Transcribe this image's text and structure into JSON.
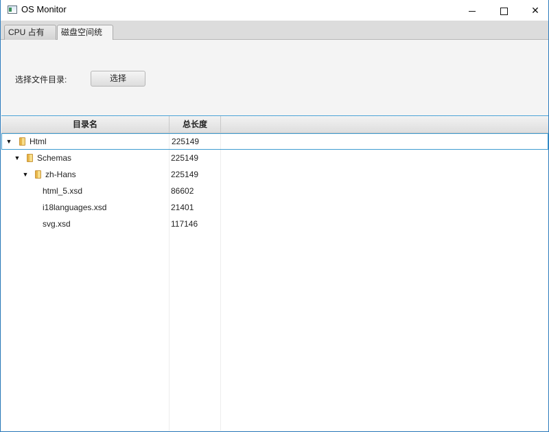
{
  "window": {
    "title": "OS Monitor",
    "controls": {
      "minimize": "minimize",
      "maximize": "maximize",
      "close": "✕"
    }
  },
  "tabs": [
    {
      "label": "CPU 占有率",
      "selected": false
    },
    {
      "label": "磁盘空间统计",
      "selected": true
    }
  ],
  "toolbar": {
    "select_dir_label": "选择文件目录:",
    "select_button": "选择"
  },
  "table": {
    "columns": [
      "目录名",
      "总长度"
    ],
    "rows": [
      {
        "name": "Html",
        "size": "225149",
        "depth": 0,
        "type": "folder",
        "expanded": true,
        "selected": true
      },
      {
        "name": "Schemas",
        "size": "225149",
        "depth": 1,
        "type": "folder",
        "expanded": true,
        "selected": false
      },
      {
        "name": "zh-Hans",
        "size": "225149",
        "depth": 2,
        "type": "folder",
        "expanded": true,
        "selected": false
      },
      {
        "name": "html_5.xsd",
        "size": "86602",
        "depth": 3,
        "type": "file",
        "selected": false
      },
      {
        "name": "i18languages.xsd",
        "size": "21401",
        "depth": 3,
        "type": "file",
        "selected": false
      },
      {
        "name": "svg.xsd",
        "size": "117146",
        "depth": 3,
        "type": "file",
        "selected": false
      }
    ]
  },
  "colors": {
    "selection_border": "#3d9bd0",
    "folder": "#e7b54a",
    "window_border": "#2b7bbd"
  },
  "icons": {
    "app": "app-window-icon",
    "folder": "folder-icon",
    "expand": "triangle-down-icon"
  }
}
